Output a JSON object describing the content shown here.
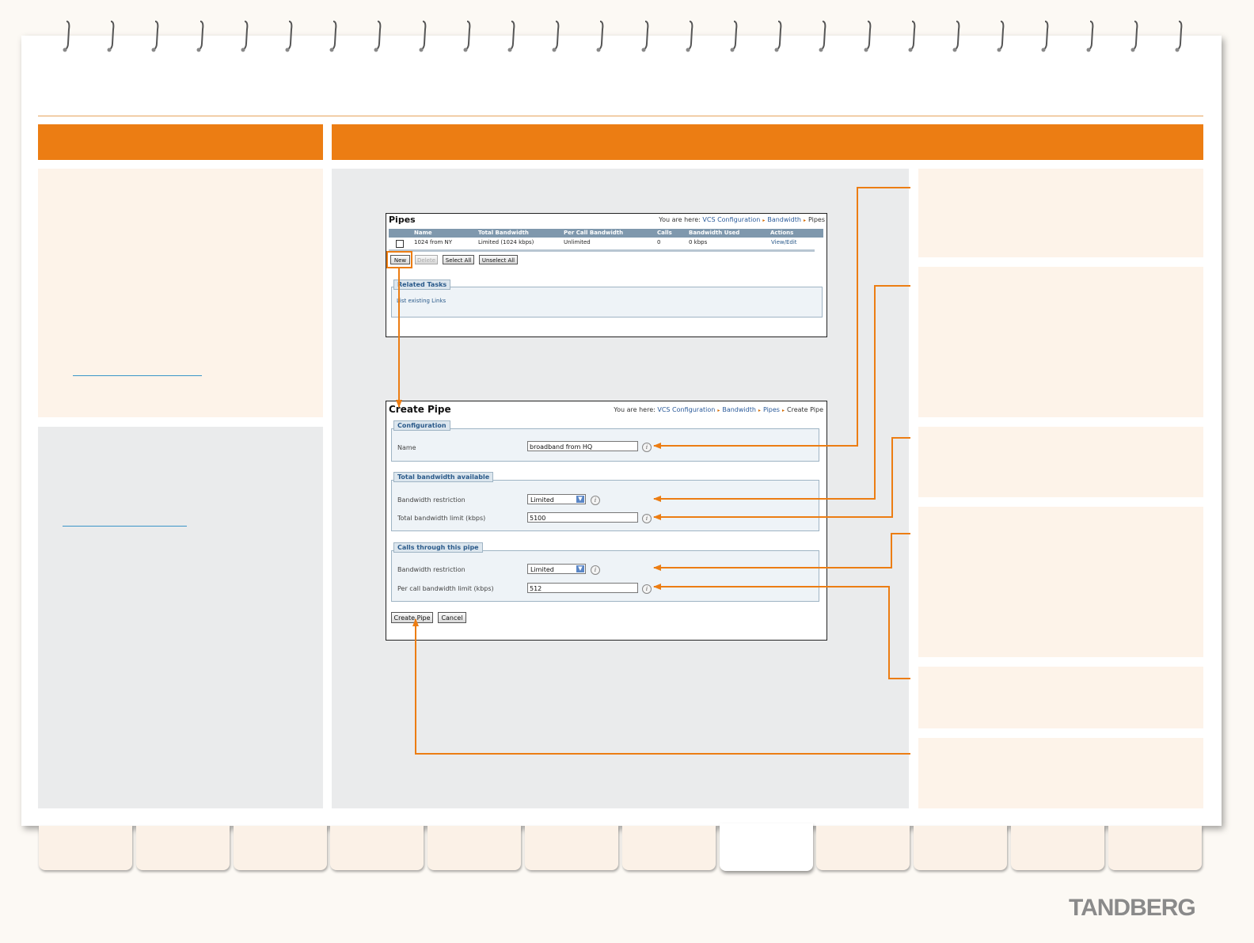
{
  "pipes_screen": {
    "title": "Pipes",
    "breadcrumb": {
      "prefix": "You are here:",
      "items": [
        "VCS Configuration",
        "Bandwidth",
        "Pipes"
      ]
    },
    "table": {
      "headers": [
        "Name",
        "Total Bandwidth",
        "Per Call Bandwidth",
        "Calls",
        "Bandwidth Used",
        "Actions"
      ],
      "rows": [
        {
          "name": "1024 from NY",
          "total": "Limited (1024 kbps)",
          "per_call": "Unlimited",
          "calls": "0",
          "used": "0 kbps",
          "actions": "View/Edit"
        }
      ]
    },
    "buttons": {
      "new": "New",
      "delete": "Delete",
      "select_all": "Select All",
      "unselect_all": "Unselect All"
    },
    "related_tasks": {
      "legend": "Related Tasks",
      "item": "List existing Links"
    }
  },
  "create_screen": {
    "title": "Create Pipe",
    "breadcrumb": {
      "prefix": "You are here:",
      "items": [
        "VCS Configuration",
        "Bandwidth",
        "Pipes"
      ],
      "current": "Create Pipe"
    },
    "configuration": {
      "legend": "Configuration",
      "name_label": "Name",
      "name_value": "broadband from HQ"
    },
    "total_bandwidth": {
      "legend": "Total bandwidth available",
      "restriction_label": "Bandwidth restriction",
      "restriction_value": "Limited",
      "limit_label": "Total bandwidth limit (kbps)",
      "limit_value": "5100"
    },
    "calls_through": {
      "legend": "Calls through this pipe",
      "restriction_label": "Bandwidth restriction",
      "restriction_value": "Limited",
      "limit_label": "Per call bandwidth limit (kbps)",
      "limit_value": "512"
    },
    "buttons": {
      "create": "Create Pipe",
      "cancel": "Cancel"
    }
  },
  "info_glyph": "i",
  "dropdown_glyph": "▼",
  "crumb_arrow": "▸",
  "logo": "TANDBERG",
  "colors": {
    "accent_orange": "#ec7d13",
    "panel_cream": "#fdf3e9",
    "panel_grey": "#eaebec",
    "link_blue": "#3a95c8"
  }
}
